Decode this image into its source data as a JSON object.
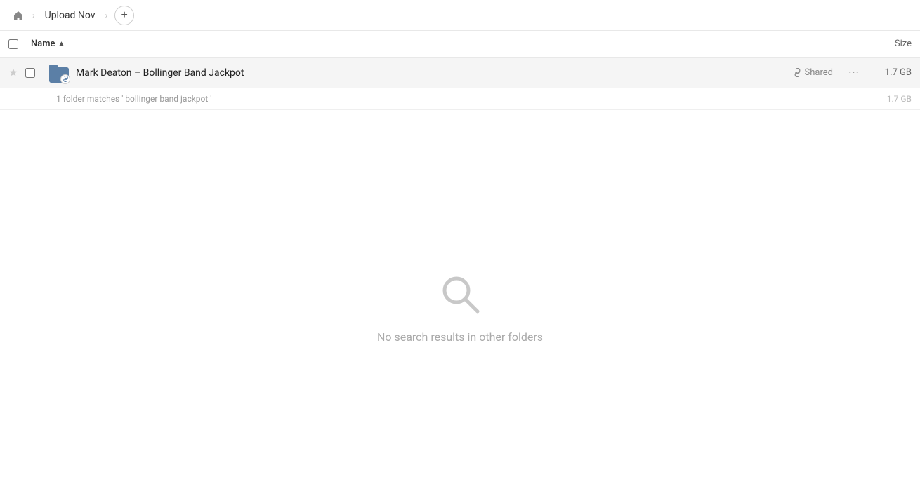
{
  "topbar": {
    "home_title": "Home",
    "breadcrumb_sep": "›",
    "folder_name": "Upload Nov",
    "add_button_label": "+"
  },
  "columns": {
    "name_label": "Name",
    "size_label": "Size"
  },
  "file_row": {
    "name": "Mark Deaton – Bollinger Band Jackpot",
    "shared_label": "Shared",
    "size": "1.7 GB",
    "more_dots": "···"
  },
  "match_info": {
    "text": "1 folder matches ' bollinger band jackpot '",
    "size": "1.7 GB"
  },
  "empty_state": {
    "message": "No search results in other folders"
  }
}
